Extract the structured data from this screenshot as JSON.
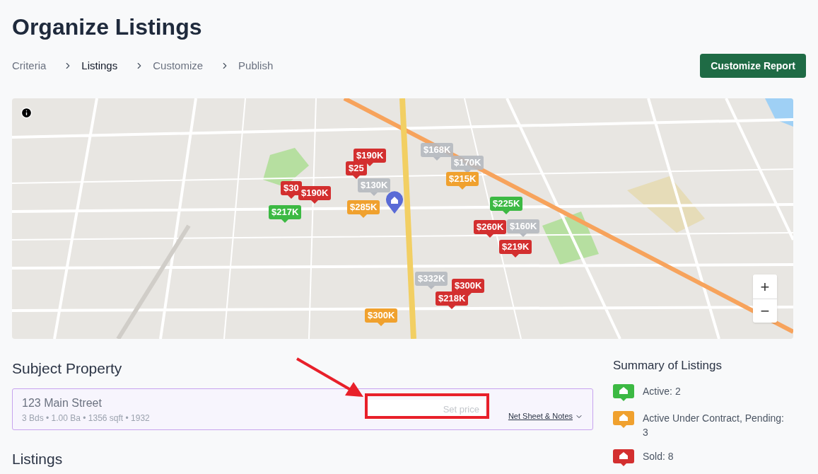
{
  "page_title": "Organize Listings",
  "breadcrumb": [
    {
      "label": "Criteria",
      "selected": false
    },
    {
      "label": "Listings",
      "selected": true
    },
    {
      "label": "Customize",
      "selected": false
    },
    {
      "label": "Publish",
      "selected": false
    }
  ],
  "primary_button": "Customize Report",
  "map": {
    "markers": [
      {
        "price": "$25",
        "kind": "sold"
      },
      {
        "price": "$190K",
        "kind": "sold"
      },
      {
        "price": "$30",
        "kind": "sold"
      },
      {
        "price": "$190K",
        "kind": "sold"
      },
      {
        "price": "$217K",
        "kind": "active"
      },
      {
        "price": "$130K",
        "kind": "other"
      },
      {
        "price": "$285K",
        "kind": "pending"
      },
      {
        "price": "$168K",
        "kind": "other"
      },
      {
        "price": "$170K",
        "kind": "other"
      },
      {
        "price": "$215K",
        "kind": "pending"
      },
      {
        "price": "$225K",
        "kind": "active"
      },
      {
        "price": "$260K",
        "kind": "sold"
      },
      {
        "price": "$160K",
        "kind": "other"
      },
      {
        "price": "$219K",
        "kind": "sold"
      },
      {
        "price": "$332K",
        "kind": "other"
      },
      {
        "price": "$300K",
        "kind": "sold"
      },
      {
        "price": "$218K",
        "kind": "sold"
      },
      {
        "price": "$300K",
        "kind": "pending"
      }
    ],
    "zoom_in": "+",
    "zoom_out": "−"
  },
  "subject": {
    "heading": "Subject Property",
    "address": "123 Main Street",
    "details": "3 Bds • 1.00 Ba • 1356 sqft • 1932",
    "price_placeholder": "Set price",
    "notes_link": "Net Sheet & Notes"
  },
  "listings_heading": "Listings",
  "summary": {
    "heading": "Summary of Listings",
    "items": [
      {
        "label": "Active: 2",
        "kind": "active"
      },
      {
        "label": "Active Under Contract, Pending: 3",
        "kind": "pending"
      },
      {
        "label": "Sold: 8",
        "kind": "sold"
      }
    ]
  }
}
